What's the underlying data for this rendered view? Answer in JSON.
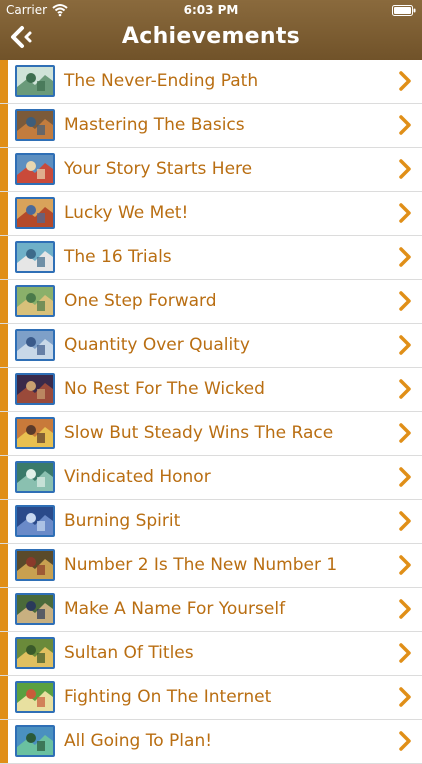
{
  "status_bar": {
    "carrier": "Carrier",
    "time": "6:03 PM"
  },
  "header": {
    "title": "Achievements",
    "back_icon": "back-arrow-icon"
  },
  "colors": {
    "header_bg": "#7d5e33",
    "accent_bar": "#e08f18",
    "label_text": "#b96e12",
    "chevron": "#e08f18",
    "thumb_border": "#2f6fb6"
  },
  "achievements": [
    {
      "label": "The Never-Ending Path"
    },
    {
      "label": "Mastering The Basics"
    },
    {
      "label": "Your Story Starts Here"
    },
    {
      "label": "Lucky We Met!"
    },
    {
      "label": "The 16 Trials"
    },
    {
      "label": "One Step Forward"
    },
    {
      "label": "Quantity Over Quality"
    },
    {
      "label": "No Rest For The Wicked"
    },
    {
      "label": "Slow But Steady Wins The Race"
    },
    {
      "label": "Vindicated Honor"
    },
    {
      "label": "Burning Spirit"
    },
    {
      "label": "Number 2 Is The New Number 1"
    },
    {
      "label": "Make A Name For Yourself"
    },
    {
      "label": "Sultan Of Titles"
    },
    {
      "label": "Fighting On The Internet"
    },
    {
      "label": "All Going To Plan!"
    }
  ]
}
